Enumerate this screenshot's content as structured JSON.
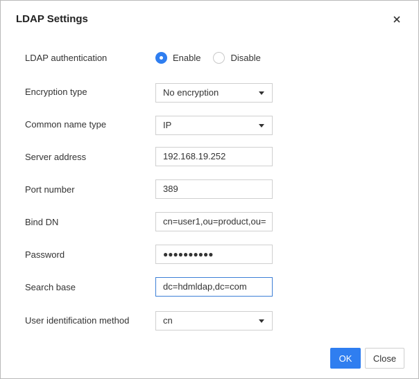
{
  "dialog": {
    "title": "LDAP Settings",
    "close_icon": "close-icon"
  },
  "fields": {
    "ldap_auth": {
      "label": "LDAP authentication",
      "options": [
        "Enable",
        "Disable"
      ],
      "selected": "Enable"
    },
    "encryption": {
      "label": "Encryption type",
      "value": "No encryption"
    },
    "common_name": {
      "label": "Common name type",
      "value": "IP"
    },
    "server_address": {
      "label": "Server address",
      "value": "192.168.19.252"
    },
    "port": {
      "label": "Port number",
      "value": "389"
    },
    "bind_dn": {
      "label": "Bind DN",
      "value": "cn=user1,ou=product,ou="
    },
    "password": {
      "label": "Password",
      "value": "●●●●●●●●●●"
    },
    "search_base": {
      "label": "Search base",
      "value": "dc=hdmldap,dc=com"
    },
    "user_id_method": {
      "label": "User identification method",
      "value": "cn"
    }
  },
  "buttons": {
    "ok": "OK",
    "close": "Close"
  },
  "colors": {
    "accent": "#2f7ef0",
    "focus_border": "#3d7fd6"
  }
}
